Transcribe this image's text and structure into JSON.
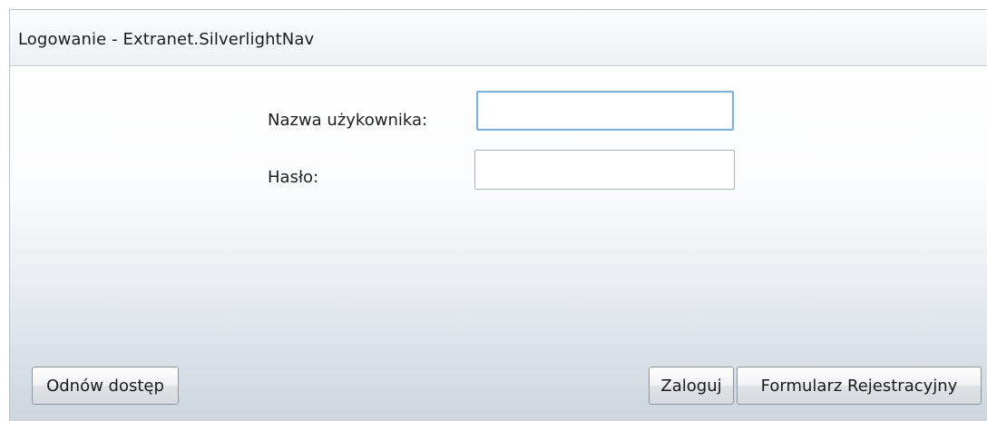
{
  "window": {
    "title": "Logowanie - Extranet.SilverlightNav"
  },
  "form": {
    "username_label": "Nazwa użykownika:",
    "username_value": "",
    "password_label": "Hasło:",
    "password_value": ""
  },
  "buttons": {
    "renew_label": "Odnów dostęp",
    "login_label": "Zaloguj",
    "register_label": "Formularz Rejestracyjny"
  },
  "colors": {
    "focus_border": "#7fb0d8",
    "window_border": "#b9c2cc"
  }
}
